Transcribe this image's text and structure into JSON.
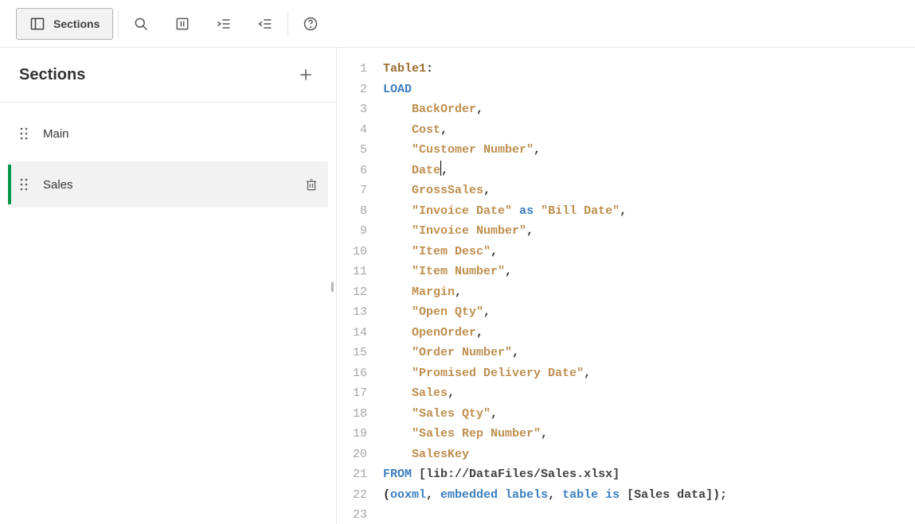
{
  "toolbar": {
    "sections_button": "Sections"
  },
  "sidebar": {
    "title": "Sections",
    "items": [
      {
        "label": "Main",
        "active": false
      },
      {
        "label": "Sales",
        "active": true
      }
    ]
  },
  "editor": {
    "lines": [
      [
        {
          "t": "table",
          "v": "Table1"
        },
        {
          "t": "punct",
          "v": ":"
        }
      ],
      [
        {
          "t": "keyword",
          "v": "LOAD"
        }
      ],
      [
        {
          "t": "indent",
          "v": "    "
        },
        {
          "t": "field",
          "v": "BackOrder"
        },
        {
          "t": "punct",
          "v": ","
        }
      ],
      [
        {
          "t": "indent",
          "v": "    "
        },
        {
          "t": "field",
          "v": "Cost"
        },
        {
          "t": "punct",
          "v": ","
        }
      ],
      [
        {
          "t": "indent",
          "v": "    "
        },
        {
          "t": "field",
          "v": "\"Customer Number\""
        },
        {
          "t": "punct",
          "v": ","
        }
      ],
      [
        {
          "t": "indent",
          "v": "    "
        },
        {
          "t": "field",
          "v": "Date"
        },
        {
          "t": "cursor",
          "v": ""
        },
        {
          "t": "punct",
          "v": ","
        }
      ],
      [
        {
          "t": "indent",
          "v": "    "
        },
        {
          "t": "field",
          "v": "GrossSales"
        },
        {
          "t": "punct",
          "v": ","
        }
      ],
      [
        {
          "t": "indent",
          "v": "    "
        },
        {
          "t": "field",
          "v": "\"Invoice Date\""
        },
        {
          "t": "punct",
          "v": " "
        },
        {
          "t": "keyword",
          "v": "as"
        },
        {
          "t": "punct",
          "v": " "
        },
        {
          "t": "field",
          "v": "\"Bill Date\""
        },
        {
          "t": "punct",
          "v": ","
        }
      ],
      [
        {
          "t": "indent",
          "v": "    "
        },
        {
          "t": "field",
          "v": "\"Invoice Number\""
        },
        {
          "t": "punct",
          "v": ","
        }
      ],
      [
        {
          "t": "indent",
          "v": "    "
        },
        {
          "t": "field",
          "v": "\"Item Desc\""
        },
        {
          "t": "punct",
          "v": ","
        }
      ],
      [
        {
          "t": "indent",
          "v": "    "
        },
        {
          "t": "field",
          "v": "\"Item Number\""
        },
        {
          "t": "punct",
          "v": ","
        }
      ],
      [
        {
          "t": "indent",
          "v": "    "
        },
        {
          "t": "field",
          "v": "Margin"
        },
        {
          "t": "punct",
          "v": ","
        }
      ],
      [
        {
          "t": "indent",
          "v": "    "
        },
        {
          "t": "field",
          "v": "\"Open Qty\""
        },
        {
          "t": "punct",
          "v": ","
        }
      ],
      [
        {
          "t": "indent",
          "v": "    "
        },
        {
          "t": "field",
          "v": "OpenOrder"
        },
        {
          "t": "punct",
          "v": ","
        }
      ],
      [
        {
          "t": "indent",
          "v": "    "
        },
        {
          "t": "field",
          "v": "\"Order Number\""
        },
        {
          "t": "punct",
          "v": ","
        }
      ],
      [
        {
          "t": "indent",
          "v": "    "
        },
        {
          "t": "field",
          "v": "\"Promised Delivery Date\""
        },
        {
          "t": "punct",
          "v": ","
        }
      ],
      [
        {
          "t": "indent",
          "v": "    "
        },
        {
          "t": "field",
          "v": "Sales"
        },
        {
          "t": "punct",
          "v": ","
        }
      ],
      [
        {
          "t": "indent",
          "v": "    "
        },
        {
          "t": "field",
          "v": "\"Sales Qty\""
        },
        {
          "t": "punct",
          "v": ","
        }
      ],
      [
        {
          "t": "indent",
          "v": "    "
        },
        {
          "t": "field",
          "v": "\"Sales Rep Number\""
        },
        {
          "t": "punct",
          "v": ","
        }
      ],
      [
        {
          "t": "indent",
          "v": "    "
        },
        {
          "t": "field",
          "v": "SalesKey"
        }
      ],
      [
        {
          "t": "keyword",
          "v": "FROM"
        },
        {
          "t": "punct",
          "v": " "
        },
        {
          "t": "bracket",
          "v": "[lib://DataFiles/Sales.xlsx]"
        }
      ],
      [
        {
          "t": "punct",
          "v": "("
        },
        {
          "t": "keyword",
          "v": "ooxml"
        },
        {
          "t": "punct",
          "v": ", "
        },
        {
          "t": "keyword",
          "v": "embedded labels"
        },
        {
          "t": "punct",
          "v": ", "
        },
        {
          "t": "keyword",
          "v": "table is"
        },
        {
          "t": "punct",
          "v": " "
        },
        {
          "t": "bracket",
          "v": "[Sales data]"
        },
        {
          "t": "punct",
          "v": ");"
        }
      ],
      []
    ]
  }
}
